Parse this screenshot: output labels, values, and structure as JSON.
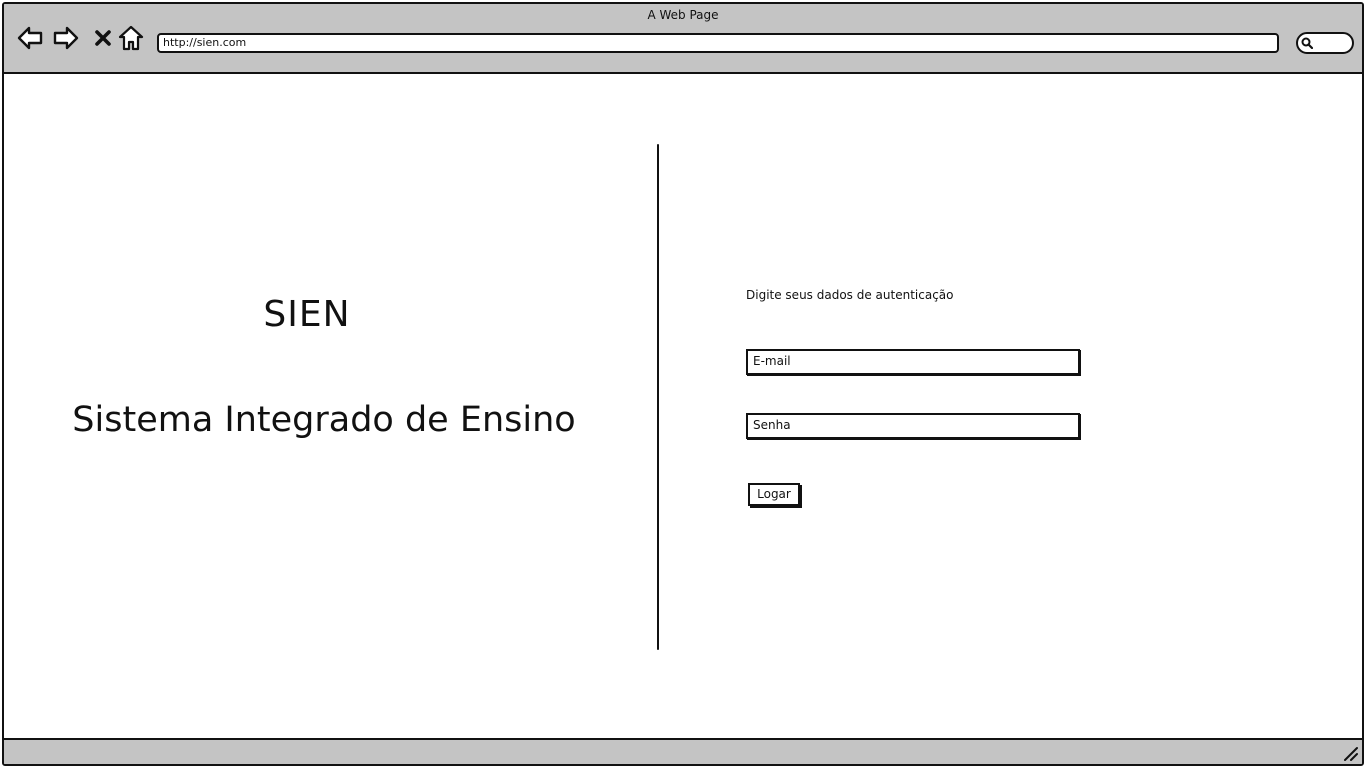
{
  "browser": {
    "window_title": "A Web Page",
    "url": "http://sien.com",
    "icons": {
      "back": "back-arrow-icon",
      "forward": "forward-arrow-icon",
      "stop": "close-icon",
      "home": "home-icon",
      "search": "search-icon",
      "resize": "resize-grip-icon"
    }
  },
  "brand": {
    "title": "SIEN",
    "subtitle": "Sistema Integrado de Ensino"
  },
  "login": {
    "prompt": "Digite seus dados de autenticação",
    "email_placeholder": "E-mail",
    "password_placeholder": "Senha",
    "submit_label": "Logar"
  },
  "colors": {
    "chrome": "#c4c4c4",
    "ink": "#111111",
    "background": "#ffffff"
  }
}
